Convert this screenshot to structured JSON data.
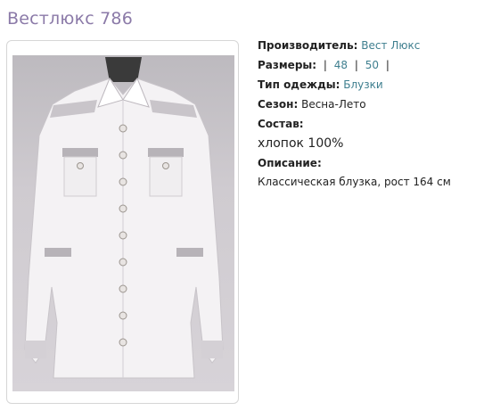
{
  "page": {
    "title": "Вестлюкс 786"
  },
  "product_image": {
    "alt": "Блузка Вестлюкс 786"
  },
  "details": {
    "manufacturer_label": "Производитель:",
    "manufacturer_value": "Вест Люкс",
    "sizes_label": "Размеры:",
    "sizes": [
      "48",
      "50"
    ],
    "sizes_sep": "|",
    "type_label": "Тип одежды:",
    "type_value": "Блузки",
    "season_label": "Сезон:",
    "season_value": "Весна-Лето",
    "composition_label": "Состав:",
    "composition_value": "хлопок 100%",
    "description_label": "Описание:",
    "description_value": "Классическая блузка, рост 164 см"
  },
  "colors": {
    "title": "#8b7aa8",
    "link": "#3f7f8f"
  }
}
